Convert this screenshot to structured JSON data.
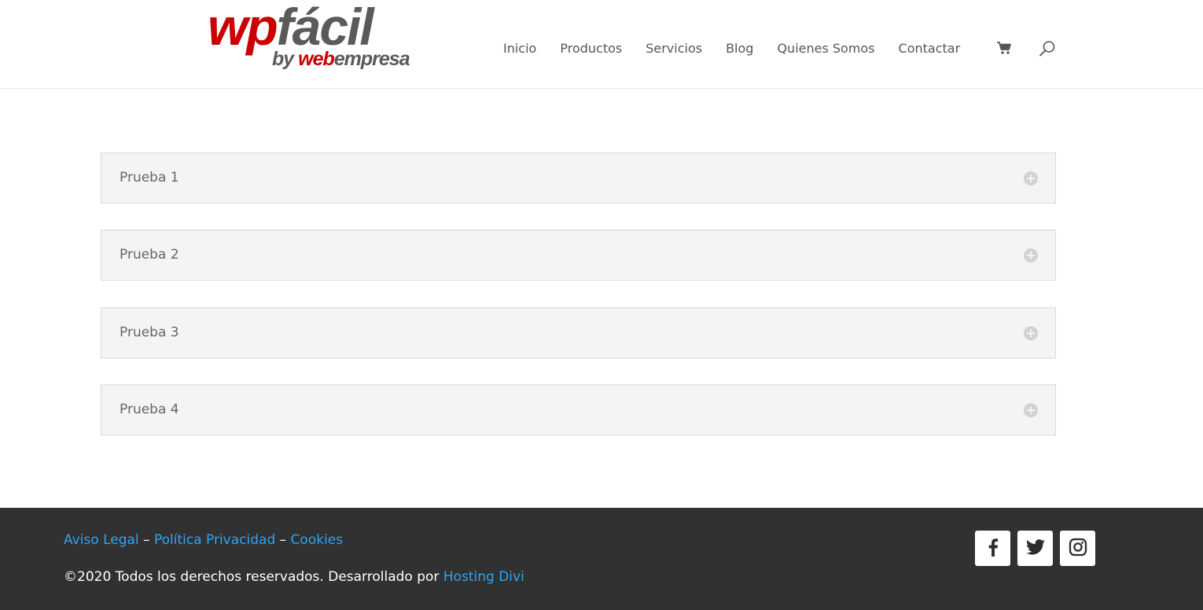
{
  "header": {
    "logo": {
      "part1": "wp",
      "part2": "fácil",
      "by": "by ",
      "web": "web",
      "empresa": "empresa"
    },
    "nav": [
      "Inicio",
      "Productos",
      "Servicios",
      "Blog",
      "Quienes Somos",
      "Contactar"
    ],
    "icons": {
      "cart": "cart-icon",
      "search": "search-icon"
    }
  },
  "accordion": {
    "items": [
      "Prueba 1",
      "Prueba 2",
      "Prueba 3",
      "Prueba 4"
    ]
  },
  "footer": {
    "links": [
      "Aviso Legal",
      "Política Privacidad",
      "Cookies"
    ],
    "separator": " – ",
    "copyright_text": "©2020 Todos los derechos reservados. Desarrollado por ",
    "copyright_link": "Hosting Divi",
    "social": [
      "facebook-icon",
      "twitter-icon",
      "instagram-icon"
    ]
  },
  "colors": {
    "brand_red": "#cc0000",
    "brand_grey": "#5a5a5a",
    "link_blue": "#2ea3f2",
    "footer_bg": "#313131",
    "accordion_bg": "#f4f4f4",
    "social_icon": "#2d2d2d"
  }
}
